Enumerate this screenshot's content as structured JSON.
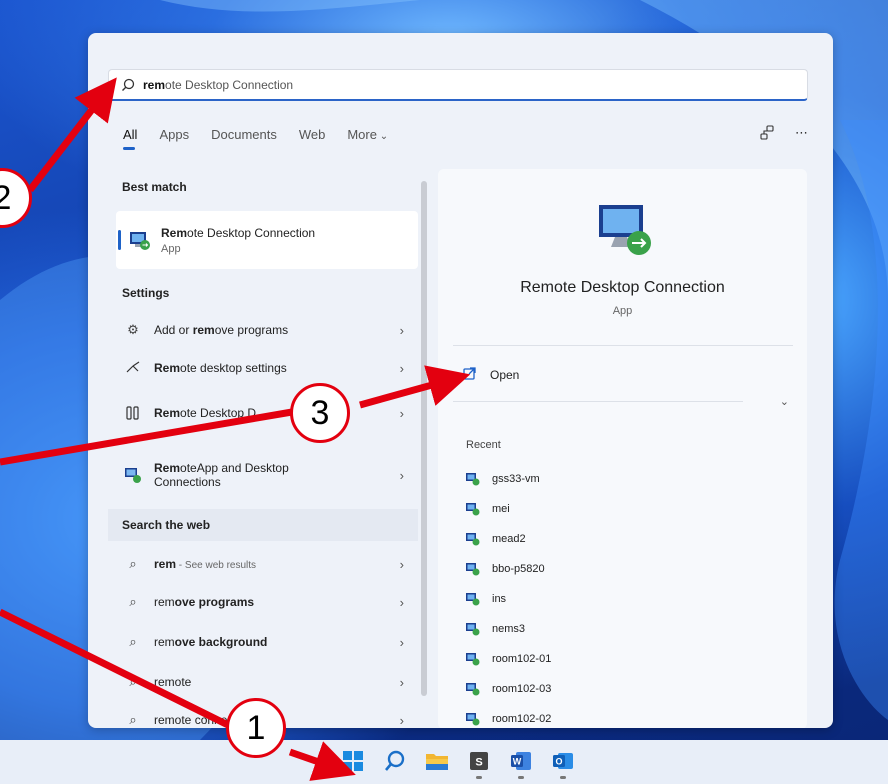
{
  "search": {
    "typed": "rem",
    "rest": "ote Desktop Connection"
  },
  "tabs": [
    {
      "label": "All",
      "active": true
    },
    {
      "label": "Apps",
      "active": false
    },
    {
      "label": "Documents",
      "active": false
    },
    {
      "label": "Web",
      "active": false
    },
    {
      "label": "More",
      "active": false
    }
  ],
  "top_right": {
    "more_icon": "ellipsis-icon",
    "share_icon": "network-icon"
  },
  "best_match": {
    "heading": "Best match",
    "item": {
      "title_bold": "Rem",
      "title_rest": "ote Desktop Connection",
      "subtitle": "App"
    }
  },
  "settings": {
    "heading": "Settings",
    "items": [
      {
        "pre": "Add or ",
        "bold": "rem",
        "post": "ove programs",
        "icon": "gear-icon"
      },
      {
        "pre": "",
        "bold": "Rem",
        "post": "ote desktop settings",
        "icon": "remote-icon"
      },
      {
        "pre": "",
        "bold": "Rem",
        "post": "ote Desktop D",
        "icon": "tools-icon"
      },
      {
        "pre": "",
        "bold": "Rem",
        "post": "oteApp and Desktop",
        "line2": "Connections",
        "icon": "remoteapp-icon"
      }
    ]
  },
  "search_web": {
    "heading": "Search the web",
    "items": [
      {
        "bold": "rem",
        "post": " - See web results"
      },
      {
        "pre": "rem",
        "bold": "ove programs",
        "post": ""
      },
      {
        "pre": "rem",
        "bold": "ove background",
        "post": ""
      },
      {
        "bold": "",
        "post": "remote"
      },
      {
        "bold": "remote",
        "post": " connection"
      }
    ]
  },
  "preview": {
    "app_name": "Remote Desktop Connection",
    "app_type": "App",
    "open_label": "Open",
    "recent_heading": "Recent",
    "recent": [
      "gss33-vm",
      "mei",
      "mead2",
      "bbo-p5820",
      "ins",
      "nems3",
      "room102-01",
      "room102-03",
      "room102-02"
    ]
  },
  "callouts": [
    "1",
    "2",
    "3"
  ],
  "colors": {
    "accent": "#1e62c8",
    "arrow": "#e3000f"
  }
}
